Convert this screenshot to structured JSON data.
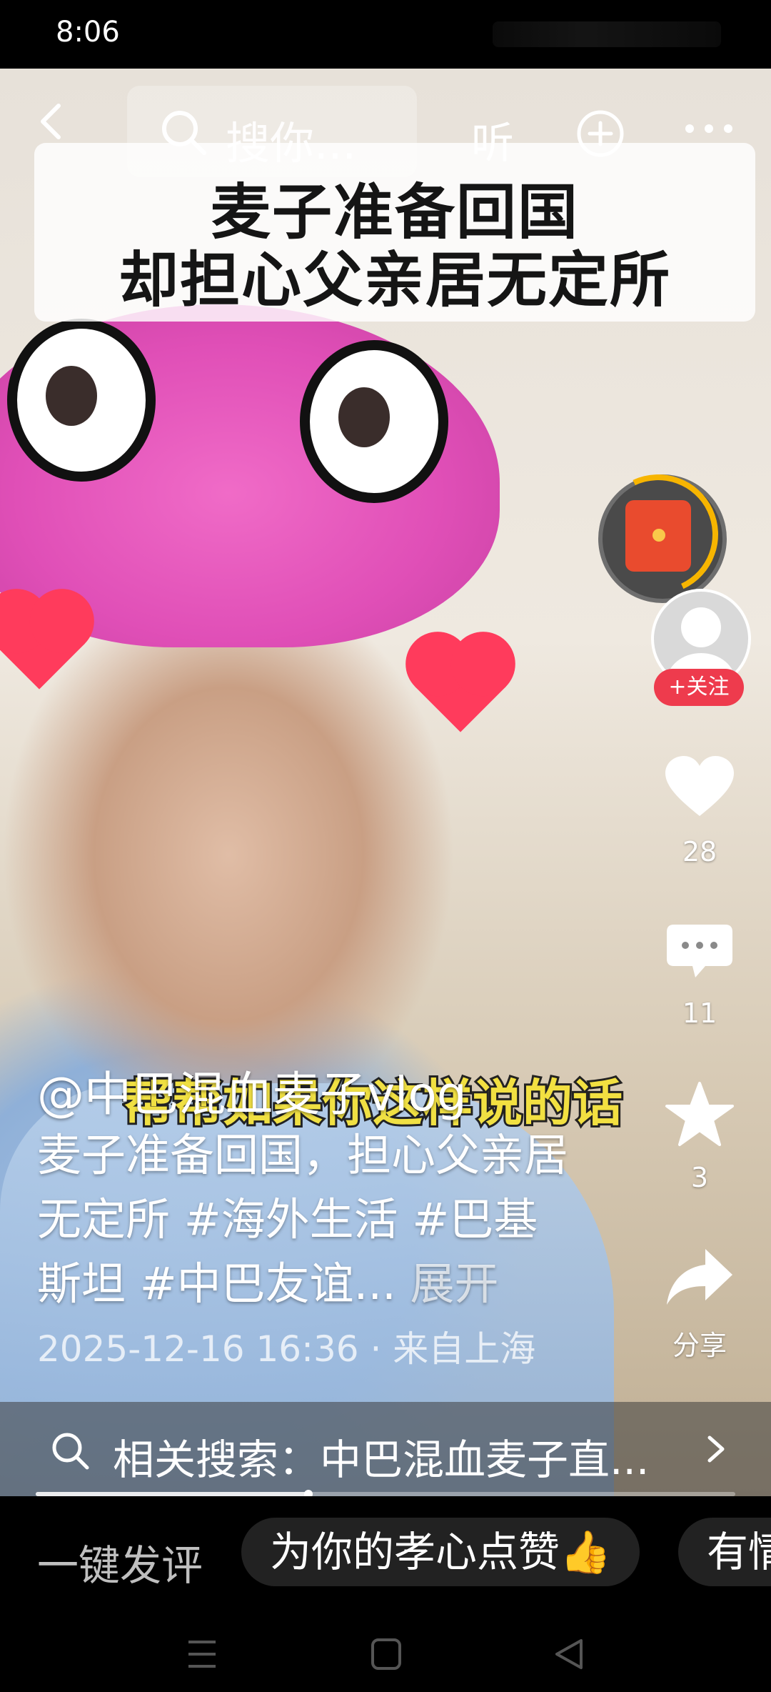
{
  "status_bar": {
    "time": "8:06"
  },
  "top_bar": {
    "search_placeholder": "搜你...",
    "listen_label": "听"
  },
  "video": {
    "title_lines": [
      "麦子准备回国",
      "却担心父亲居无定所"
    ],
    "subtitle": "帮帮如果你这样说的话"
  },
  "post": {
    "author": "@中巴混血麦子vlog",
    "description": "麦子准备回国，担心父亲居无定所 #海外生活 #巴基斯坦 #中巴友谊... ",
    "expand_label": "展开",
    "meta": "2025-12-16 16:36 · 来自上海"
  },
  "rail": {
    "follow_label": "+关注",
    "likes": "28",
    "comments": "11",
    "favorites": "3",
    "share_label": "分享"
  },
  "related": {
    "text": "相关搜索：中巴混血麦子直..."
  },
  "progress": {
    "fraction": 0.39
  },
  "comment_bar": {
    "label": "一键发评",
    "chips": [
      "为你的孝心点赞👍",
      "有情"
    ]
  },
  "icons": [
    "back-icon",
    "search-icon",
    "plus-circle-icon",
    "more-icon",
    "red-packet-icon",
    "heart-icon",
    "comment-icon",
    "star-icon",
    "share-icon",
    "chevron-right-icon",
    "menu-nav-icon",
    "home-nav-icon",
    "back-nav-icon"
  ],
  "colors": {
    "follow": "#ee3b4d",
    "ring": "#f7b500",
    "like": "#ffffff"
  }
}
